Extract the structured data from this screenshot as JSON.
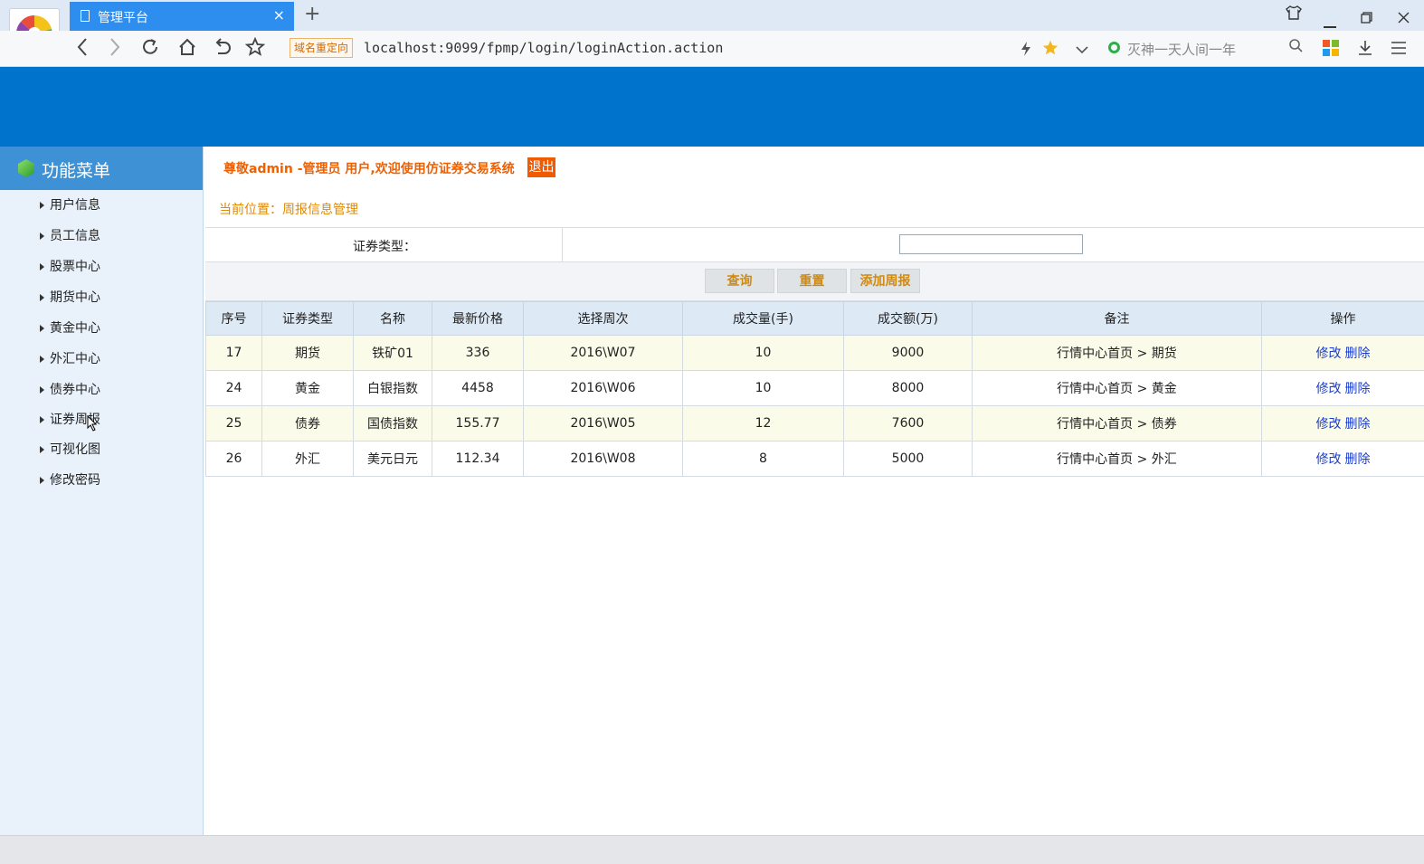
{
  "browser": {
    "tab_title": "管理平台",
    "tab_close": "×",
    "new_tab": "+",
    "redirect_badge": "域名重定向",
    "url": "localhost:9099/fpmp/login/loginAction.action",
    "search_placeholder": "灭神一天人间一年",
    "icons": [
      "browser-logo-icon",
      "document-icon",
      "close-icon",
      "plus-icon",
      "shirt-icon",
      "minimize-icon",
      "restore-icon",
      "window-close-icon",
      "back-icon",
      "forward-icon",
      "reload-icon",
      "home-icon",
      "undo-icon",
      "star-outline-icon",
      "bolt-icon",
      "star-filled-icon",
      "chevron-down-icon",
      "search-icon",
      "apps-icon",
      "download-icon",
      "menu-icon"
    ]
  },
  "sidebar": {
    "title": "功能菜单",
    "items": [
      {
        "label": "用户信息"
      },
      {
        "label": "员工信息"
      },
      {
        "label": "股票中心"
      },
      {
        "label": "期货中心"
      },
      {
        "label": "黄金中心"
      },
      {
        "label": "外汇中心"
      },
      {
        "label": "债券中心"
      },
      {
        "label": "证券周报"
      },
      {
        "label": "可视化图"
      },
      {
        "label": "修改密码"
      }
    ]
  },
  "header": {
    "welcome": "尊敬admin -管理员 用户,欢迎使用仿证券交易系统",
    "logout": "退出",
    "breadcrumb": "当前位置：周报信息管理"
  },
  "search": {
    "label": "证券类型：",
    "value": "",
    "buttons": {
      "query": "查询",
      "reset": "重置",
      "add": "添加周报"
    }
  },
  "table": {
    "columns": [
      "序号",
      "证券类型",
      "名称",
      "最新价格",
      "选择周次",
      "成交量(手)",
      "成交额(万)",
      "备注",
      "操作"
    ],
    "rows": [
      {
        "id": "17",
        "type": "期货",
        "name": "铁矿01",
        "price": "336",
        "week": "2016\\W07",
        "volume": "10",
        "amount": "9000",
        "remark": "行情中心首页 > 期货",
        "edit": "修改",
        "delete": "删除"
      },
      {
        "id": "24",
        "type": "黄金",
        "name": "白银指数",
        "price": "4458",
        "week": "2016\\W06",
        "volume": "10",
        "amount": "8000",
        "remark": "行情中心首页 > 黄金",
        "edit": "修改",
        "delete": "删除"
      },
      {
        "id": "25",
        "type": "债券",
        "name": "国债指数",
        "price": "155.77",
        "week": "2016\\W05",
        "volume": "12",
        "amount": "7600",
        "remark": "行情中心首页 > 债券",
        "edit": "修改",
        "delete": "删除"
      },
      {
        "id": "26",
        "type": "外汇",
        "name": "美元日元",
        "price": "112.34",
        "week": "2016\\W08",
        "volume": "8",
        "amount": "5000",
        "remark": "行情中心首页 > 外汇",
        "edit": "修改",
        "delete": "删除"
      }
    ]
  },
  "colors": {
    "banner": "#0074cc",
    "sidebar_head": "#3d91d4",
    "welcome_text": "#f06000",
    "breadcrumb_text": "#e08a00",
    "link": "#1a3ccc"
  }
}
